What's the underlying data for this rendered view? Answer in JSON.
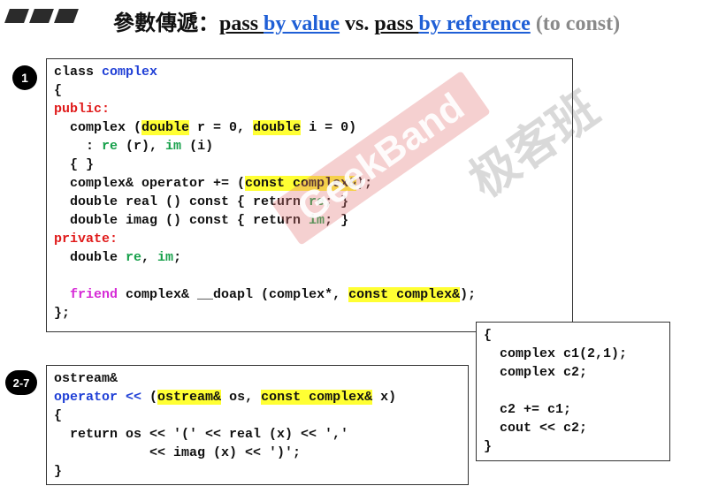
{
  "title": {
    "prefix": "參數傳遞：",
    "part1": "pass ",
    "part2": "by value",
    "part3": " vs. ",
    "part4": "pass ",
    "part5": "by reference",
    "part6": " (to const)"
  },
  "badges": {
    "b1": "1",
    "b2": "2-7"
  },
  "box1": {
    "l1a": "class ",
    "l1b": "complex",
    "l2": "{",
    "l3": "public:",
    "l4a": "  complex (",
    "l4b": "double",
    "l4c": " r = 0, ",
    "l4d": "double",
    "l4e": " i = 0)",
    "l5a": "    : ",
    "l5b": "re",
    "l5c": " (r), ",
    "l5d": "im",
    "l5e": " (i)",
    "l6": "  { }",
    "l7a": "  complex& operator += (",
    "l7b": "const complex&",
    "l7c": ");",
    "l8a": "  double real () const { return ",
    "l8b": "re",
    "l8c": "; }",
    "l9a": "  double imag () const { return ",
    "l9b": "im",
    "l9c": "; }",
    "l10": "private:",
    "l11a": "  double ",
    "l11b": "re",
    "l11c": ", ",
    "l11d": "im",
    "l11e": ";",
    "l12a": "  ",
    "l12b": "friend",
    "l12c": " complex& __doapl (complex*, ",
    "l12d": "const complex&",
    "l12e": ");",
    "l13": "};"
  },
  "box2": {
    "l1": "{",
    "l2": "  complex c1(2,1);",
    "l3": "  complex c2;",
    "l4": "  c2 += c1;",
    "l5": "  cout << c2;",
    "l6": "}"
  },
  "box3": {
    "l1": "ostream&",
    "l2a": "operator <<",
    "l2b": " (",
    "l2c": "ostream&",
    "l2d": " os, ",
    "l2e": "const complex&",
    "l2f": " x)",
    "l3": "{",
    "l4": "  return os << '(' << real (x) << ','",
    "l5": "            << imag (x) << ')';",
    "l6": "}"
  },
  "watermark": {
    "band": "GeekBand",
    "cn": "极客班"
  }
}
